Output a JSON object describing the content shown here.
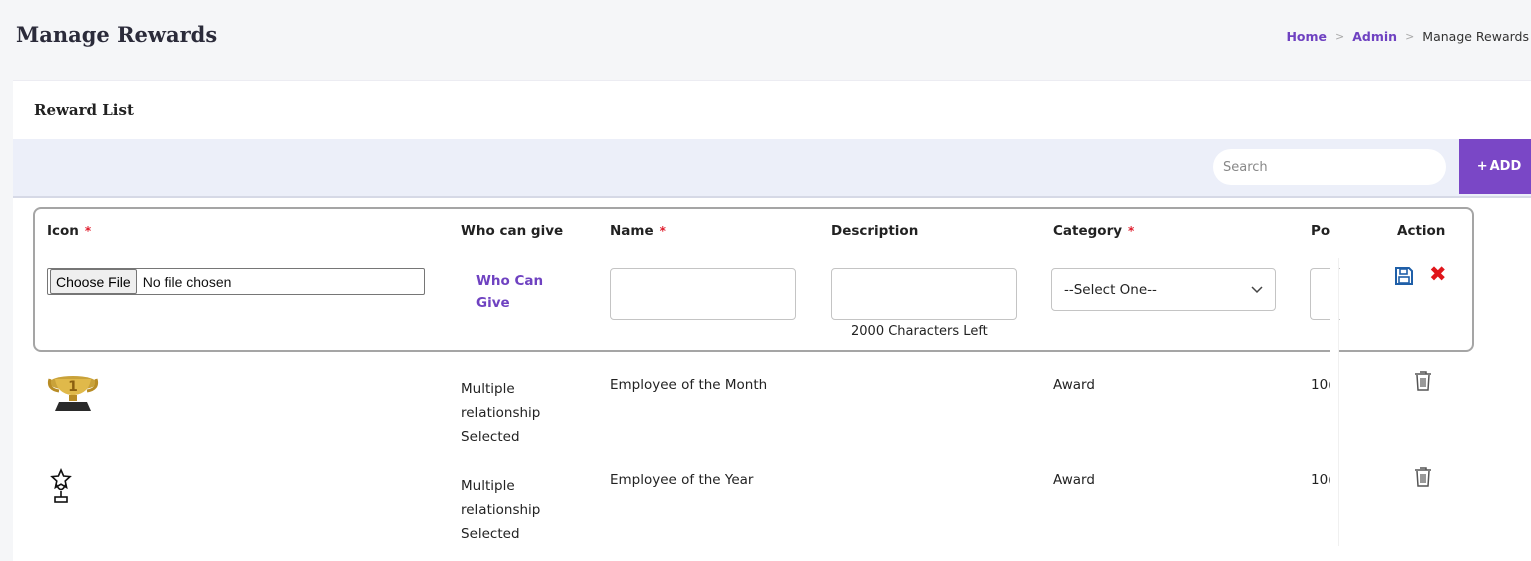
{
  "page": {
    "title": "Manage Rewards",
    "breadcrumb": {
      "home": "Home",
      "admin": "Admin",
      "current": "Manage Rewards",
      "separator": ">"
    }
  },
  "card": {
    "title": "Reward List",
    "search": {
      "placeholder": "Search",
      "value": ""
    },
    "add_label": "ADD",
    "add_icon": "+"
  },
  "table": {
    "columns": [
      {
        "label": "Icon",
        "required": true
      },
      {
        "label": "Who can give",
        "required": false
      },
      {
        "label": "Name",
        "required": true
      },
      {
        "label": "Description",
        "required": false
      },
      {
        "label": "Category",
        "required": true
      },
      {
        "label": "Po",
        "required": false
      },
      {
        "label": "Action",
        "required": false
      }
    ],
    "required_marker": "*",
    "edit_row": {
      "file_button": "Choose File",
      "file_status": "No file chosen",
      "who_can_give_link": "Who Can Give",
      "name_value": "",
      "description_value": "",
      "chars_left": "2000 Characters Left",
      "category_selected": "--Select One--",
      "points_value": "",
      "save_icon": "floppy-disk-icon",
      "cancel_icon": "x-icon",
      "cancel_glyph": "✖",
      "accent_color": "#1f5fa8",
      "cancel_color": "#e0161b"
    },
    "rows": [
      {
        "icon": "gold-trophy-number-1-icon",
        "who_can_give": "Multiple relationship Selected",
        "name": "Employee of the Month",
        "description": "",
        "category": "Award",
        "points": "10(",
        "action_icon": "trash-icon"
      },
      {
        "icon": "star-trophy-outline-icon",
        "who_can_give": "Multiple relationship Selected",
        "name": "Employee of the Year",
        "description": "",
        "category": "Award",
        "points": "10(",
        "action_icon": "trash-icon"
      }
    ]
  },
  "colors": {
    "brand_purple": "#7a47c6",
    "link_purple": "#6f42c1",
    "toolbar_bg": "#eceff9",
    "required_red": "#e01e2e"
  }
}
